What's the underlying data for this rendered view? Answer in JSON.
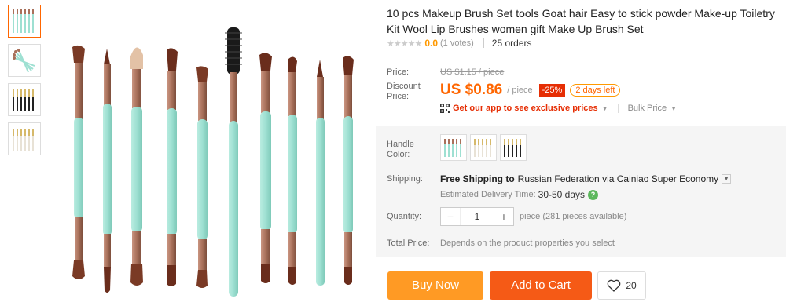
{
  "product": {
    "title": "10 pcs Makeup Brush Set tools Goat hair Easy to stick powder Make-up Toiletry Kit Wool Lip Brushes women gift Make Up Brush Set",
    "rating": {
      "stars_icon": "star-rating-icon",
      "value": "0.0",
      "votes": "(1 votes)",
      "orders": "25 orders"
    }
  },
  "gallery": {
    "thumbnails": [
      "mint-brush-set",
      "mint-brush-fan",
      "black-gold-brush-set",
      "white-gold-brush-set"
    ],
    "main_image": "mint-makeup-brushes"
  },
  "price": {
    "price_label": "Price:",
    "old_price": "US $1.15 / piece",
    "discount_label": "Discount Price:",
    "current_price": "US $0.86",
    "per_unit": "/ piece",
    "discount_badge": "-25%",
    "days_left": "2 days left",
    "app_promo": "Get our app to see exclusive prices",
    "bulk_price": "Bulk Price"
  },
  "options": {
    "handle_color_label": "Handle Color:",
    "swatches": [
      "mint-handles",
      "gold-handles",
      "black-handles"
    ]
  },
  "shipping": {
    "label": "Shipping:",
    "free": "Free Shipping to",
    "destination": "Russian Federation via Cainiao Super Economy",
    "est_label": "Estimated Delivery Time:",
    "est_value": "30-50 days"
  },
  "quantity": {
    "label": "Quantity:",
    "minus": "−",
    "value": "1",
    "plus": "+",
    "note": "piece (281 pieces available)"
  },
  "total": {
    "label": "Total Price:",
    "note": "Depends on the product properties you select"
  },
  "actions": {
    "buy_now": "Buy Now",
    "add_to_cart": "Add to Cart",
    "wishlist_count": "20"
  },
  "colors": {
    "accent_orange": "#f60",
    "buy_now": "#ff9a24",
    "add_to_cart": "#f55a16",
    "discount_red": "#e62e04",
    "brush_handle_mint": "#9ee0d2",
    "ferrule_rose_gold": "#a8705a"
  }
}
